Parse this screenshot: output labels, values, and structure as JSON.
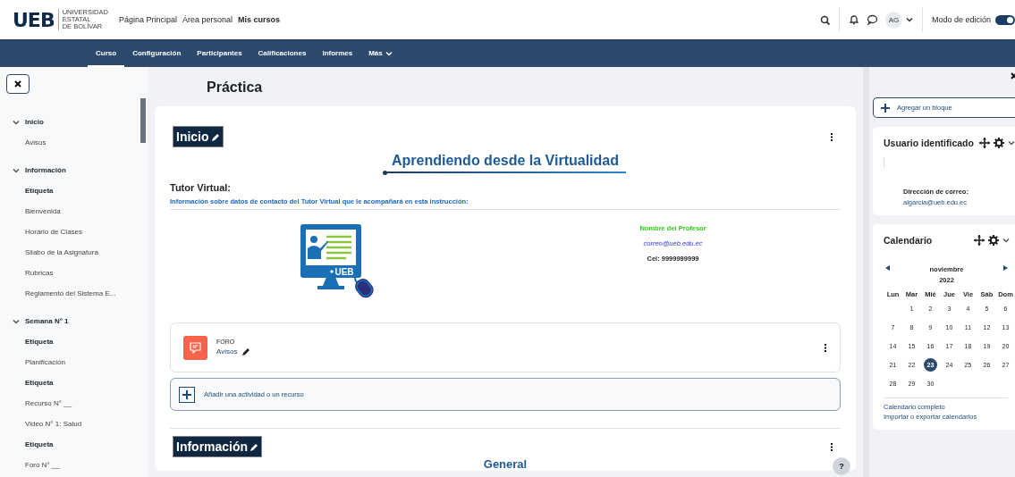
{
  "header": {
    "logo": "UEB",
    "logo_lines": [
      "UNIVERSIDAD",
      "ESTATAL",
      "DE BOLÍVAR"
    ],
    "links": [
      {
        "label": "Página Principal",
        "selected": false
      },
      {
        "label": "Área personal",
        "selected": false
      },
      {
        "label": "Mis cursos",
        "selected": true
      }
    ],
    "avatar": "AG",
    "edit_mode": {
      "label": "Modo de edición",
      "on": true
    }
  },
  "course_nav": [
    {
      "label": "Curso",
      "selected": true
    },
    {
      "label": "Configuración",
      "selected": false
    },
    {
      "label": "Participantes",
      "selected": false
    },
    {
      "label": "Calificaciones",
      "selected": false
    },
    {
      "label": "Informes",
      "selected": false
    },
    {
      "label": "Más",
      "selected": false
    }
  ],
  "course_index": [
    {
      "label": "Inicio",
      "expanded": true,
      "children": [
        {
          "label": "Avisos",
          "kind": "activity"
        }
      ]
    },
    {
      "label": "Información",
      "expanded": true,
      "children": [
        {
          "label": "Etiqueta",
          "kind": "label"
        },
        {
          "label": "Bienvenida",
          "kind": "activity"
        },
        {
          "label": "Horario de Clases",
          "kind": "activity"
        },
        {
          "label": "Silabo de la Asignatura",
          "kind": "activity"
        },
        {
          "label": "Rubricas",
          "kind": "activity"
        },
        {
          "label": "Reglamento del Sistema E...",
          "kind": "activity"
        }
      ]
    },
    {
      "label": "Semana N° 1",
      "expanded": true,
      "children": [
        {
          "label": "Etiqueta",
          "kind": "label"
        },
        {
          "label": "Planificación",
          "kind": "activity"
        },
        {
          "label": "Etiqueta",
          "kind": "label"
        },
        {
          "label": "Recurso N° __",
          "kind": "activity"
        },
        {
          "label": "Video N° 1: Salud",
          "kind": "activity"
        },
        {
          "label": "Etiqueta",
          "kind": "label"
        },
        {
          "label": "Foro N° __",
          "kind": "activity"
        }
      ]
    }
  ],
  "main": {
    "title": "Práctica",
    "sections": [
      {
        "heading": "Inicio",
        "banner": "Aprendiendo desde la Virtualidad",
        "tutor_title": "Tutor Virtual:",
        "tutor_info": "Información sobre datos de contacto del Tutor Virtual que le acompañará en esta instrucción:",
        "teacher_name": "Nombre del Profesor",
        "teacher_email": "correo@ueb.edu.ec",
        "teacher_phone": "Cel: 9999999999",
        "illustration_badge": "UEB",
        "activities": [
          {
            "type": "FORO",
            "name": "Avisos"
          }
        ],
        "add_activity": "Añadir una actividad o un recurso"
      },
      {
        "heading": "Información",
        "banner": "General"
      }
    ],
    "help": "?"
  },
  "blocks": {
    "add_block": "Agregar un bloque",
    "user_block": {
      "title": "Usuario identificado",
      "email_label": "Dirección de correo:",
      "email": "algarcia@ueb.edu.ec"
    },
    "calendar": {
      "title": "Calendario",
      "month": "noviembre",
      "year": "2022",
      "weekdays": [
        "Lun",
        "Mar",
        "Mié",
        "Jue",
        "Vie",
        "Sáb",
        "Dom"
      ],
      "weeks": [
        [
          {
            "day": "1",
            "selected": false
          },
          {
            "day": "2",
            "selected": false
          },
          {
            "day": "3",
            "selected": false
          },
          {
            "day": "4",
            "selected": false
          },
          {
            "day": "5",
            "selected": false
          },
          {
            "day": "6",
            "selected": false
          }
        ],
        [
          {
            "day": "7",
            "selected": false
          },
          {
            "day": "8",
            "selected": false
          },
          {
            "day": "9",
            "selected": false
          },
          {
            "day": "10",
            "selected": false
          },
          {
            "day": "11",
            "selected": false
          },
          {
            "day": "12",
            "selected": false
          },
          {
            "day": "13",
            "selected": false
          }
        ],
        [
          {
            "day": "14",
            "selected": false
          },
          {
            "day": "15",
            "selected": false
          },
          {
            "day": "16",
            "selected": false
          },
          {
            "day": "17",
            "selected": false
          },
          {
            "day": "18",
            "selected": false
          },
          {
            "day": "19",
            "selected": false
          },
          {
            "day": "20",
            "selected": false
          }
        ],
        [
          {
            "day": "21",
            "selected": false
          },
          {
            "day": "22",
            "selected": false
          },
          {
            "day": "23",
            "selected": true
          },
          {
            "day": "24",
            "selected": false
          },
          {
            "day": "25",
            "selected": false
          },
          {
            "day": "26",
            "selected": false
          },
          {
            "day": "27",
            "selected": false
          }
        ],
        [
          {
            "day": "28",
            "selected": false
          },
          {
            "day": "29",
            "selected": false
          },
          {
            "day": "30",
            "selected": false
          }
        ]
      ],
      "links": [
        "Calendario completo",
        "Importar o exportar calendarios"
      ]
    }
  }
}
